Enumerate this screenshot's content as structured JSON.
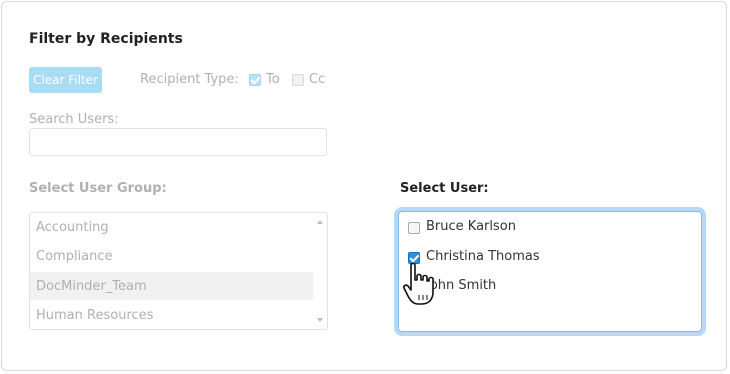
{
  "filter": {
    "title": "Filter by Recipients",
    "clear_button": "Clear Filter",
    "recipient_type_label": "Recipient Type:",
    "recipient_types": [
      {
        "label": "To",
        "checked": true
      },
      {
        "label": "Cc",
        "checked": false
      }
    ],
    "search_label": "Search Users:",
    "search_value": "",
    "user_group_label": "Select User Group:",
    "user_groups": [
      "Accounting",
      "Compliance",
      "DocMinder_Team",
      "Human Resources"
    ],
    "selected_group": "DocMinder_Team",
    "user_label": "Select User:",
    "users": [
      {
        "label": "Bruce Karlson",
        "checked": false
      },
      {
        "label": "Christina Thomas",
        "checked": true
      },
      {
        "label": "John Smith",
        "checked": false
      }
    ]
  },
  "colors": {
    "accent": "#2d8fe0",
    "clear_button_bg": "#a8dcf5",
    "focus_ring": "#b6d9f7",
    "disabled_text": "#b0b0b0"
  },
  "icons": {
    "cursor": "hand-pointer-icon",
    "scroll_up": "scroll-up-arrow-icon",
    "scroll_down": "scroll-down-arrow-icon"
  }
}
